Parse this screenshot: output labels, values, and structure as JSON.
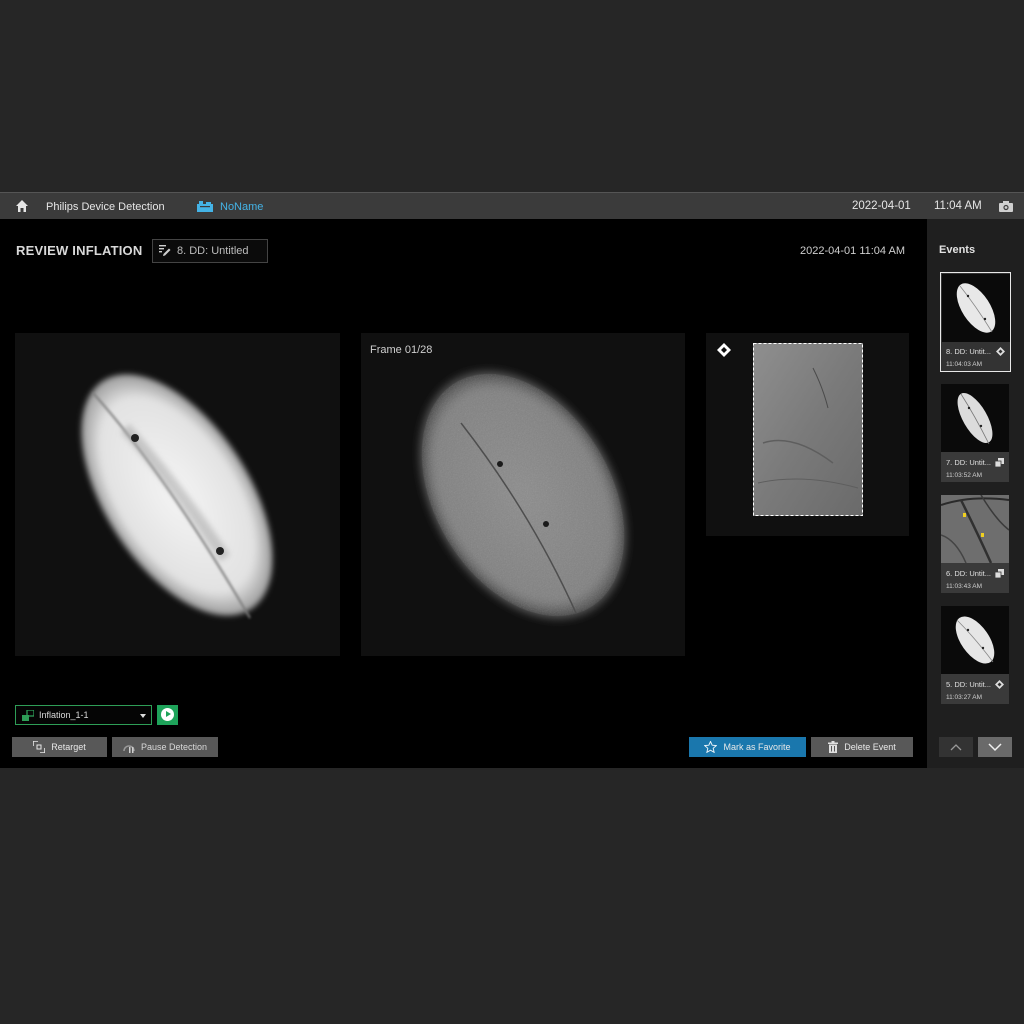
{
  "topbar": {
    "app_name": "Philips Device Detection",
    "patient_name": "NoName",
    "date": "2022-04-01",
    "time": "11:04 AM"
  },
  "main": {
    "title": "REVIEW INFLATION",
    "event_name": "8. DD: Untitled",
    "timestamp": "2022-04-01 11:04 AM",
    "frame_label": "Frame 01/28"
  },
  "controls": {
    "sequence_select": "Inflation_1-1",
    "retarget_label": "Retarget",
    "pause_label": "Pause Detection",
    "favorite_label": "Mark as Favorite",
    "delete_label": "Delete Event"
  },
  "sidebar": {
    "title": "Events",
    "events": [
      {
        "name": "8. DD: Untit...",
        "time": "11:04:03 AM",
        "icon": "overview-icon"
      },
      {
        "name": "7. DD: Untit...",
        "time": "11:03:52 AM",
        "icon": "copy-icon"
      },
      {
        "name": "6. DD: Untit...",
        "time": "11:03:43 AM",
        "icon": "copy-icon"
      },
      {
        "name": "5. DD: Untit...",
        "time": "11:03:27 AM",
        "icon": "overview-icon"
      }
    ]
  },
  "colors": {
    "accent_blue": "#1a77ad",
    "patient_blue": "#44b3e6",
    "active_green": "#1ea35a"
  }
}
